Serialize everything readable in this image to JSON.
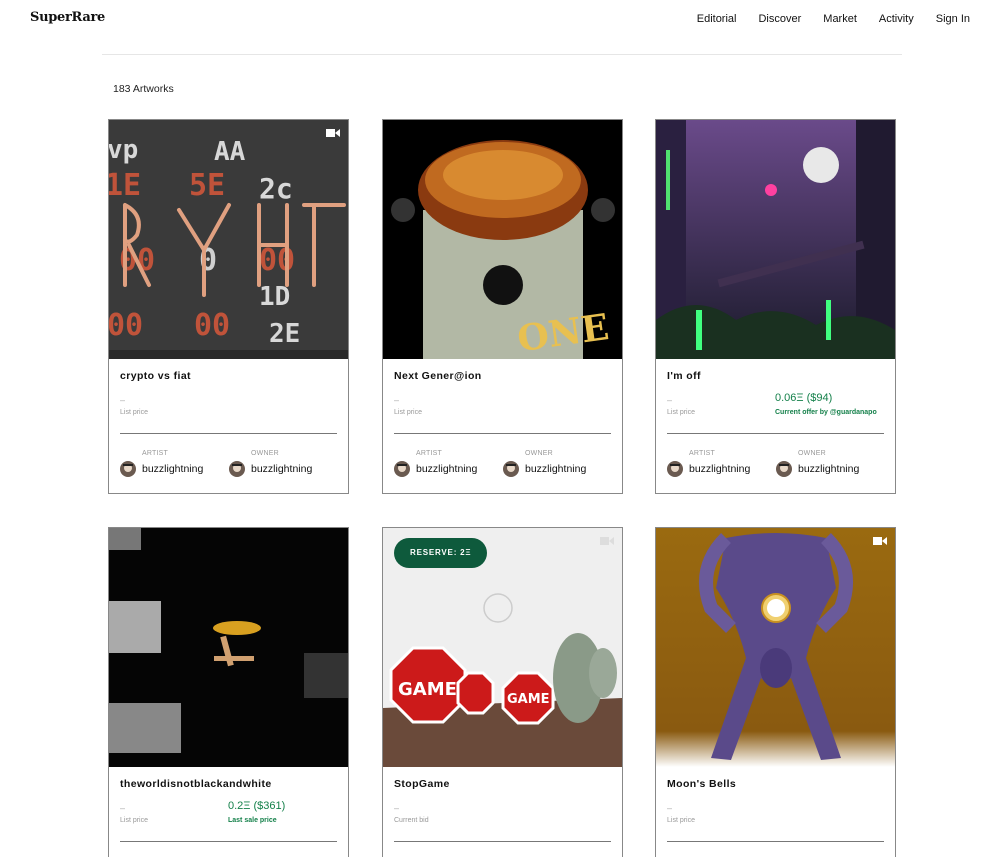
{
  "brand": {
    "logo": "SuperRare"
  },
  "nav": {
    "items": [
      "Editorial",
      "Discover",
      "Market",
      "Activity",
      "Sign In"
    ]
  },
  "listing": {
    "count_label": "183 Artworks"
  },
  "roles": {
    "artist": "ARTIST",
    "owner": "OWNER"
  },
  "cards": [
    {
      "title": "crypto vs fiat",
      "price": "–",
      "price_label": "List price",
      "artist": "buzzlightning",
      "owner": "buzzlightning",
      "video": true
    },
    {
      "title": "Next Gener@ion",
      "price": "–",
      "price_label": "List price",
      "artist": "buzzlightning",
      "owner": "buzzlightning",
      "video": false
    },
    {
      "title": "I'm off",
      "price": "–",
      "price_label": "List price",
      "offer_value": "0.06Ξ ($94)",
      "offer_label": "Current offer by @guardanapo",
      "artist": "buzzlightning",
      "owner": "buzzlightning",
      "video": false
    },
    {
      "title": "theworldisnotblackandwhite",
      "price": "–",
      "price_label": "List price",
      "sale_value": "0.2Ξ ($361)",
      "sale_label": "Last sale price",
      "video": false
    },
    {
      "title": "StopGame",
      "price": "–",
      "price_label": "Current bid",
      "badge": "RESERVE: 2Ξ",
      "game_text": "GAME",
      "video": true
    },
    {
      "title": "Moon's Bells",
      "price": "–",
      "price_label": "List price",
      "video": true
    }
  ],
  "colors": {
    "accent_green": "#14804a",
    "badge_green": "#0e5a3c"
  }
}
